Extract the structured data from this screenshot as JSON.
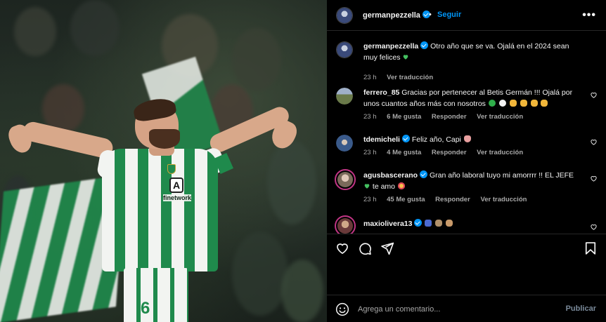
{
  "post": {
    "author": "germanpezzella",
    "separator": "•",
    "follow_label": "Seguir",
    "more_label": "•••",
    "shorts_number": "6",
    "sponsor_logo": "A",
    "sponsor_text": "finetwork"
  },
  "comments": [
    {
      "user": "germanpezzella",
      "verified": true,
      "text": "Otro año que se va. Ojalá en el 2024 sean muy felices",
      "emojis": [
        "green-heart"
      ],
      "time": "23 h",
      "likes": "",
      "reply": "",
      "translate": "Ver traducción",
      "avatar_color": "#6f7f9f",
      "has_like_button": false
    },
    {
      "user": "ferrero_85",
      "verified": false,
      "text": "Gracias por pertenecer al Betis Germán !!! Ojalá por unos cuantos años más con nosotros",
      "emojis": [
        "green-circle",
        "white-circle",
        "flexed-biceps",
        "flexed-biceps",
        "flexed-biceps",
        "flexed-biceps"
      ],
      "time": "23 h",
      "likes": "6 Me gusta",
      "reply": "Responder",
      "translate": "Ver traducción",
      "avatar_color": "#8a9a6a",
      "has_like_button": true
    },
    {
      "user": "tdemicheli",
      "verified": true,
      "text": "Feliz año, Capi",
      "emojis": [
        "heart-hands"
      ],
      "time": "23 h",
      "likes": "4 Me gusta",
      "reply": "Responder",
      "translate": "Ver traducción",
      "avatar_color": "#4f6a8f",
      "has_like_button": true
    },
    {
      "user": "agusbascerano",
      "verified": true,
      "text": "Gran año laboral tuyo mi amorrrr !! EL JEFE",
      "text2": "te amo",
      "emojis": [
        "green-heart"
      ],
      "emojis2": [
        "heart-eyes"
      ],
      "time": "23 h",
      "likes": "45 Me gusta",
      "reply": "Responder",
      "translate": "Ver traducción",
      "avatar_color": "#b08a7a",
      "has_like_button": true
    },
    {
      "user": "maxiolivera13",
      "verified": true,
      "text": "",
      "emojis": [
        "trophy-blue",
        "raised-hands",
        "clap"
      ],
      "time": "",
      "likes": "",
      "reply": "",
      "translate": "",
      "avatar_color": "#9a5a6a",
      "has_like_button": true
    }
  ],
  "actions": {
    "like_icon": "heart-outline-icon",
    "comment_icon": "comment-bubble-icon",
    "share_icon": "send-paper-plane-icon",
    "save_icon": "bookmark-icon"
  },
  "add_comment": {
    "placeholder": "Agrega un comentario...",
    "publish_label": "Publicar",
    "emoji_icon": "smiley-icon"
  },
  "colors": {
    "background": "#000000",
    "accent": "#0095f6",
    "muted_text": "#a8a8a8",
    "betis_green": "#1f8a4c"
  }
}
